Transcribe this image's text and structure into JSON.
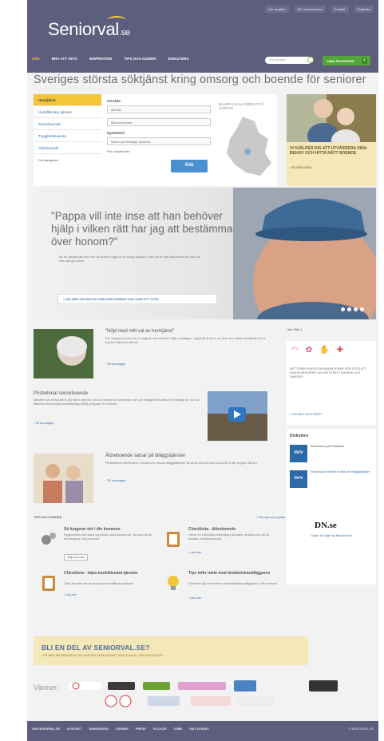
{
  "top_links": [
    "Om en gåva",
    "För verksamheter",
    "Kontakt",
    "Engelska"
  ],
  "logo": {
    "name": "Seniorval",
    "tld": ".se"
  },
  "nav": [
    "SÖK",
    "BRA ATT VETA",
    "INSPIRATION",
    "TIPS OCH GUIDER",
    "DISKUTERA"
  ],
  "search": {
    "placeholder": "Sök på sajten"
  },
  "favorites": {
    "label": "DINA FAVORITER",
    "count": "0"
  },
  "headline": "Sveriges största söktjänst kring omsorg och boende för seniorer",
  "finder": {
    "tabs": [
      "Hemtjänst",
      "Hushållsnära tjänster",
      "Seniorboende",
      "Trygghetsboende",
      "Äldreboende"
    ],
    "compare": "Din kategorier",
    "area_label": "Område",
    "area_value": "Alla län",
    "kommun_value": "Alla kommuner",
    "keyword_label": "Nyckelord",
    "keyword_placeholder": "Namn på företaget, sjukhus...",
    "checkbox": "Fler sökalternativ",
    "search_btn": "Sök",
    "map_text": "ELLER KLICKA DIREKT PÅ KARTAN"
  },
  "help": {
    "title": "VI HJÄLPER DIG ATT UTVÄRDERA DINA BEHOV OCH HITTA RÄTT BOENDE",
    "link": "› SE VÅR GUIDE"
  },
  "banner": {
    "quote": "\"Pappa vill inte inse att han behöver hjälp i vilken rätt har jag att bestämma över honom?\"",
    "body": "Att ha närstående som inte vill ta emot hjälp är en vanlig situation. Men det är inte alltid enkelt att veta hur man ska gå vidare.",
    "button": "› LÄS MER OM HUR DU SOM NÄRSTÅENDE KAN VARA ETT STÖD"
  },
  "articles": [
    {
      "title": "\"Nöjd med mitt val av hemtjänst\"",
      "text": "För många kommer det en dag då man behöver hjälp i vardagen. Ingrid 86 år är en av dem, hon valde hemtjänst och är mycket nöjd med sitt val.",
      "link": "› Till reportaget"
    },
    {
      "title": "Prisbelönat seniorboende",
      "text": "Aktivitet och ett socialt liv gör att vi mår bra. Att som senior ha ett boende som ger möjlighet till detta är ett viktigt val. Se vad Malmös kommunala bostadsbolag (MKB) erbjuder för seniorer.",
      "link": "› Till reportaget"
    },
    {
      "title": "Äldreboende satsar på tilläggstjänster",
      "text": "På äldreboendet Bohem i Stockholm erbjuds tilläggstjänster så att de boende ska kunna få en lite lyxigare tillvaro.",
      "link": "› Till reportaget"
    }
  ],
  "tips": {
    "title": "TIPS OCH GUIDER",
    "more": "› Fler tips och guider",
    "items": [
      {
        "title": "Så fungerar det i din kommun",
        "text": "Regelverken kan skilja sig mellan olika kommuner. Ta reda på hur det fungerar i din kommun.",
        "link": "Välj kommun"
      },
      {
        "title": "Checklista - äldreboende",
        "text": "Här är en checklista med frågor på saker att tänka på när du besöker ett äldreboende.",
        "link": "› Läs mer"
      },
      {
        "title": "Checklista - köpa hushållsnära tjänster",
        "text": "Tänk på detta när du ska köpa hushållsnära tjänster.",
        "link": "› Läs mer"
      },
      {
        "title": "Tips inför möte med biståndshandläggaren",
        "text": "Förbered dig inför mötet med biståndshandläggaren i din kommun.",
        "link": "› Läs mer"
      }
    ]
  },
  "right": {
    "social": "Like  Gilla  1",
    "cause_text": "SETT FRÅN FEMTIO ORGANISATIONER GÖR STÖD ATT HJÄLPA SENIORER OCH HITTA RÄTT BOENDE OCH OMSORG",
    "cause_link": "› LÄS MER OM STÖDET",
    "disk_title": "Diskutera",
    "disk_page": "Seniorval.se på Facebook",
    "disk_post": "Seniorval.se delade en länk om tilläggstjänster",
    "dn": "DN.se",
    "dn_text": "Guide: Så väljer du äldreboende"
  },
  "cta": {
    "title": "BLI EN DEL AV SENIORVAL.SE?",
    "sub": "› FÅ MER INFORMATION OM HUR DIN VERKSAMHET KAN SYNAS I VÅR SÖKTJÄNST"
  },
  "partners": {
    "label": "Vänner:"
  },
  "footer": {
    "links": [
      "OM SENIORVAL.SE",
      "KONTAKT",
      "ANNONSERA",
      "VÄNNER",
      "PRESS",
      "VILLKOR",
      "JOBB",
      "OM COOKIES"
    ],
    "copy": "© SENIORVAL.SE"
  }
}
